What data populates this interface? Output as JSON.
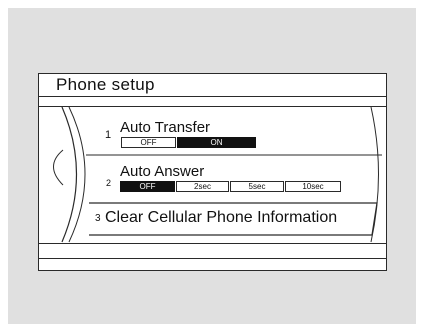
{
  "screen": {
    "title": "Phone setup"
  },
  "menu": {
    "items": [
      {
        "number": "1",
        "label": "Auto Transfer",
        "options": [
          {
            "label": "OFF",
            "selected": false
          },
          {
            "label": "ON",
            "selected": true
          }
        ]
      },
      {
        "number": "2",
        "label": "Auto Answer",
        "options": [
          {
            "label": "OFF",
            "selected": true
          },
          {
            "label": "2sec",
            "selected": false
          },
          {
            "label": "5sec",
            "selected": false
          },
          {
            "label": "10sec",
            "selected": false
          }
        ]
      },
      {
        "number": "3",
        "label": "Clear Cellular Phone Information",
        "selected": true
      }
    ]
  },
  "colors": {
    "backdrop": "#e0e0e0",
    "line": "#2a2a2a",
    "selected_fill": "#111111"
  }
}
